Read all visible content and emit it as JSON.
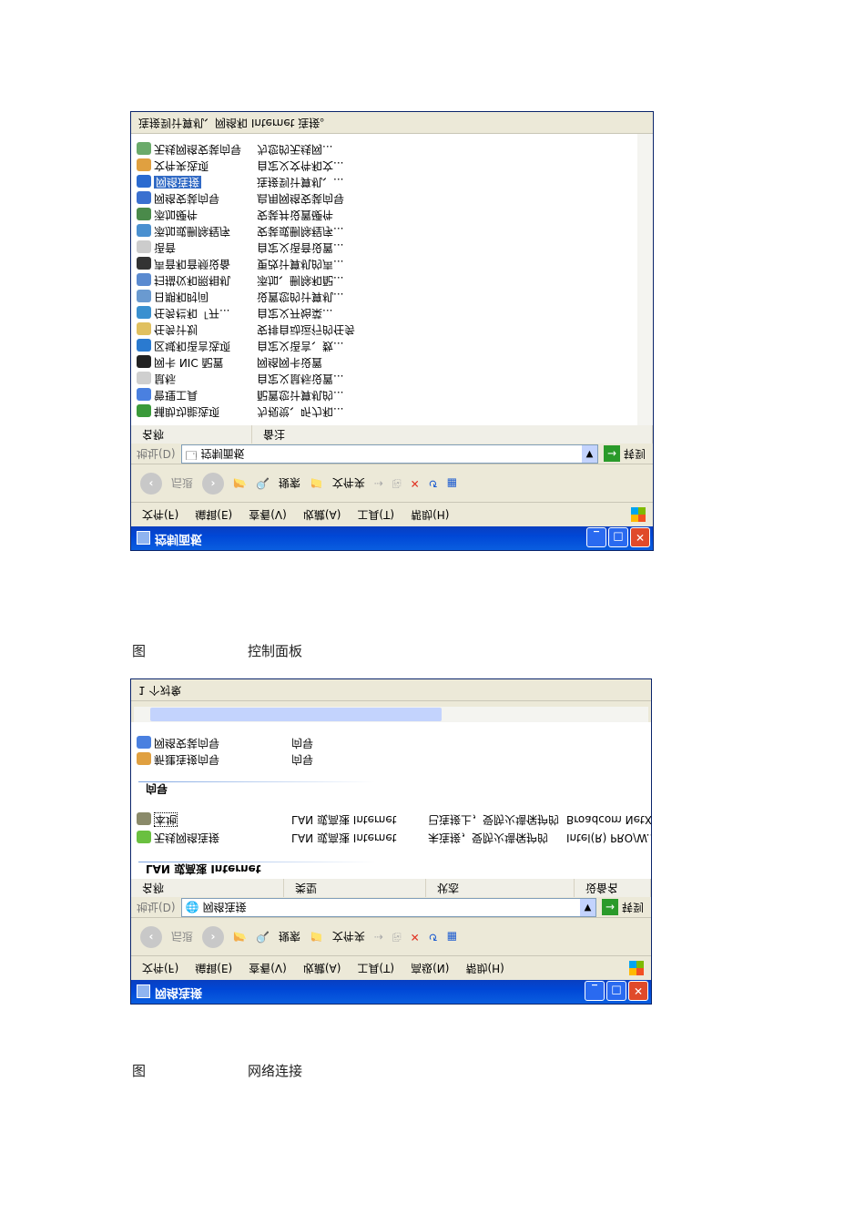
{
  "figure1": {
    "title": "控制面板",
    "menu": [
      "文件(F)",
      "编辑(E)",
      "查看(V)",
      "收藏(A)",
      "工具(T)",
      "帮助(H)"
    ],
    "toolbar": {
      "back": "后退",
      "search": "搜索",
      "folders": "文件夹"
    },
    "address": {
      "label": "地址(D)",
      "value": "控制面板",
      "go": "转到"
    },
    "columns": [
      "名称",
      "备注"
    ],
    "items": [
      {
        "name": "辅助功能选项",
        "note": "为视觉、听力和..."
      },
      {
        "name": "管理工具",
        "note": "配置您计算机的..."
      },
      {
        "name": "鼠标",
        "note": "自定义鼠标设置..."
      },
      {
        "name": "网卡 NIC 配置",
        "note": "网络网卡设置"
      },
      {
        "name": "区域和语言选项",
        "note": "自定义语言、数..."
      },
      {
        "name": "任务计划",
        "note": "安排自动运行的任务"
      },
      {
        "name": "任务栏和「开...",
        "note": "自定义开始菜..."
      },
      {
        "name": "日期和时间",
        "note": "设置您的计算机..."
      },
      {
        "name": "扫描仪和照相机",
        "note": "添加、删除和配..."
      },
      {
        "name": "声音和音频设备",
        "note": "更改计算机的声..."
      },
      {
        "name": "语音",
        "note": "自定义语音设置..."
      },
      {
        "name": "添加或删除程序",
        "note": "安装或删除程序..."
      },
      {
        "name": "添加硬件",
        "note": "安装并设置硬件"
      },
      {
        "name": "网络安装向导",
        "note": "启用网络安装向导"
      },
      {
        "name": "网络连接",
        "note": "连接到计算机、..."
      },
      {
        "name": "文件夹选项",
        "note": "自定义文件和文..."
      },
      {
        "name": "无线网络安装向导",
        "note": "为您的无线网..."
      }
    ],
    "status": "连接到计算机、网络和 Internet 连接。",
    "caption_prefix": "图",
    "caption": "控制面板"
  },
  "figure2": {
    "title": "网络连接",
    "menu": [
      "文件(F)",
      "编辑(E)",
      "查看(V)",
      "收藏(A)",
      "工具(T)",
      "高级(N)",
      "帮助(H)"
    ],
    "toolbar": {
      "back": "后退",
      "search": "搜索",
      "folders": "文件夹"
    },
    "address": {
      "label": "地址(D)",
      "value": "网络连接",
      "go": "转到"
    },
    "columns": [
      "名称",
      "类型",
      "状态",
      "设备名"
    ],
    "group_lan": "LAN 或高速 Internet",
    "lan_rows": [
      {
        "name": "无线网络连接",
        "type": "LAN 或高速 Internet",
        "status": "未连接，受防火墙保护的",
        "device": "Intel(R) PRO/W..."
      },
      {
        "name": "本地",
        "type": "LAN 或高速 Internet",
        "status": "已连接上，受防火墙保护的",
        "device": "Broadcom NetX..."
      }
    ],
    "group_wizard": "向导",
    "wizard_rows": [
      {
        "name": "新建连接向导",
        "type": "向导"
      },
      {
        "name": "网络安装向导",
        "type": "向导"
      }
    ],
    "status": "1 个对象",
    "caption_prefix": "图",
    "caption": "网络连接"
  }
}
